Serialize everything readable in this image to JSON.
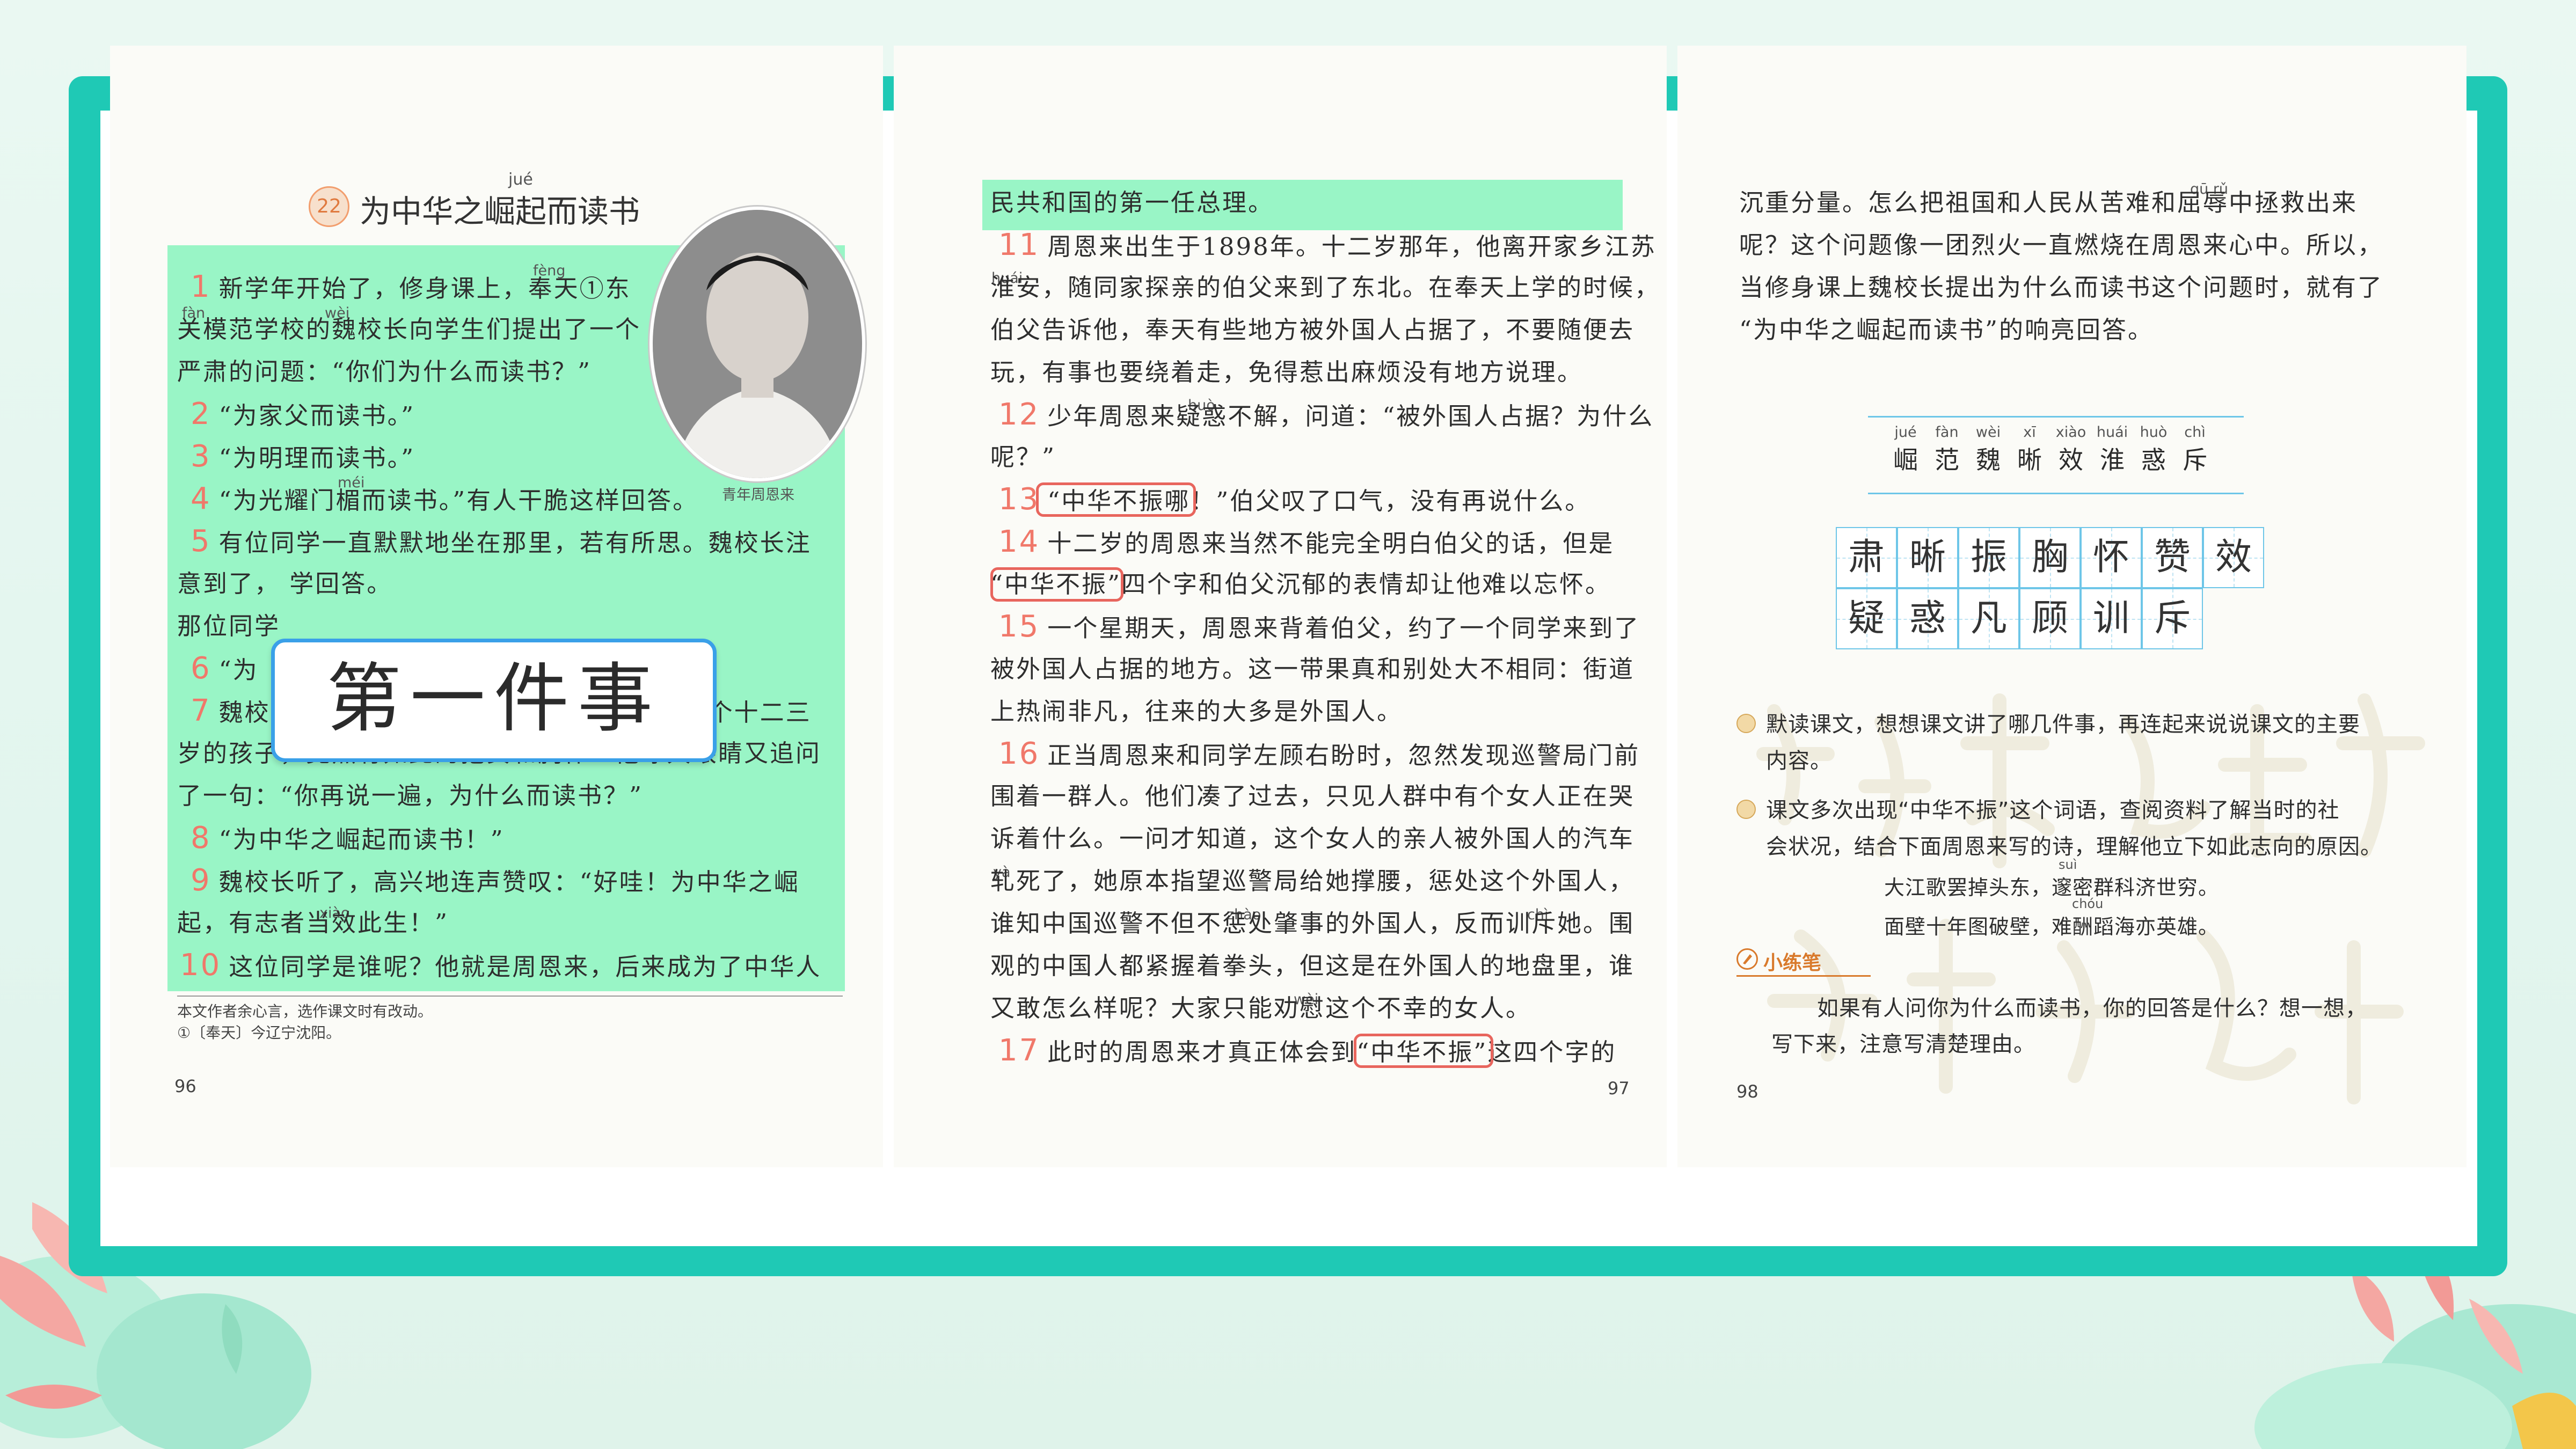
{
  "page1": {
    "lesson_number": "22",
    "title": "为中华之崛起而读书",
    "title_pinyin": "jué",
    "photo_caption": "青年周恩来",
    "lines": [
      {
        "num": "1",
        "text": "新学年开始了，修身课上，奉天①东"
      },
      {
        "num": "",
        "text": "关模范学校的魏校长向学生们提出了一个"
      },
      {
        "num": "",
        "text": "严肃的问题：“你们为什么而读书？”"
      },
      {
        "num": "2",
        "text": "“为家父而读书。”"
      },
      {
        "num": "3",
        "text": "“为明理而读书。”"
      },
      {
        "num": "4",
        "text": "“为光耀门楣而读书。”有人干脆这样回答。"
      },
      {
        "num": "5",
        "text": "有位同学一直默默地坐在那里，若有所思。魏校长注"
      },
      {
        "num": "",
        "text": "意到了，                                                    学回答。"
      },
      {
        "num": "",
        "text": "那位同学"
      },
      {
        "num": "6",
        "text": "“为"
      },
      {
        "num": "7",
        "text": "魏校长听了为之一振！他怎么也没想到，一个十二三"
      },
      {
        "num": "",
        "text": "岁的孩子，竟然有如此的抱负和胸怀！他睁大眼睛又追问"
      },
      {
        "num": "",
        "text": "了一句：“你再说一遍，为什么而读书？”"
      },
      {
        "num": "8",
        "text": "“为中华之崛起而读书！”"
      },
      {
        "num": "9",
        "text": "魏校长听了，高兴地连声赞叹：“好哇！为中华之崛"
      },
      {
        "num": "",
        "text": "起，有志者当效此生！”"
      },
      {
        "num": "10",
        "text": "这位同学是谁呢？他就是周恩来，后来成为了中华人"
      }
    ],
    "pinyin_notes": [
      "fèng",
      "fàn",
      "wèi",
      "méi",
      "xiào"
    ],
    "overlay_label": "第一件事",
    "footnote_1": "本文作者余心言，选作课文时有改动。",
    "footnote_2": "①〔奉天〕今辽宁沈阳。",
    "page_number": "96"
  },
  "page2": {
    "lines": [
      {
        "num": "",
        "text": "民共和国的第一任总理。"
      },
      {
        "num": "11",
        "text": "周恩来出生于1898年。十二岁那年，他离开家乡江苏"
      },
      {
        "num": "",
        "text": "淮安，随同家探亲的伯父来到了东北。在奉天上学的时候，"
      },
      {
        "num": "",
        "text": "伯父告诉他，奉天有些地方被外国人占据了，不要随便去"
      },
      {
        "num": "",
        "text": "玩，有事也要绕着走，免得惹出麻烦没有地方说理。"
      },
      {
        "num": "12",
        "text": "少年周恩来疑惑不解，问道：“被外国人占据？为什么"
      },
      {
        "num": "",
        "text": "呢？”"
      },
      {
        "num": "13",
        "text": "“中华不振哪！”伯父叹了口气，没有再说什么。"
      },
      {
        "num": "14",
        "text": "十二岁的周恩来当然不能完全明白伯父的话，但是"
      },
      {
        "num": "",
        "text": "“中华不振”四个字和伯父沉郁的表情却让他难以忘怀。"
      },
      {
        "num": "15",
        "text": "一个星期天，周恩来背着伯父，约了一个同学来到了"
      },
      {
        "num": "",
        "text": "被外国人占据的地方。这一带果真和别处大不相同：街道"
      },
      {
        "num": "",
        "text": "上热闹非凡，往来的大多是外国人。"
      },
      {
        "num": "16",
        "text": "正当周恩来和同学左顾右盼时，忽然发现巡警局门前"
      },
      {
        "num": "",
        "text": "围着一群人。他们凑了过去，只见人群中有个女人正在哭"
      },
      {
        "num": "",
        "text": "诉着什么。一问才知道，这个女人的亲人被外国人的汽车"
      },
      {
        "num": "",
        "text": "轧死了，她原本指望巡警局给她撑腰，惩处这个外国人，"
      },
      {
        "num": "",
        "text": "谁知中国巡警不但不惩处肇事的外国人，反而训斥她。围"
      },
      {
        "num": "",
        "text": "观的中国人都紧握着拳头，但这是在外国人的地盘里，谁"
      },
      {
        "num": "",
        "text": "又敢怎么样呢？大家只能劝慰这个不幸的女人。"
      },
      {
        "num": "17",
        "text": "此时的周恩来才真正体会到“中华不振”这四个字的"
      }
    ],
    "pinyin_notes": [
      "huái",
      "huò",
      "yà",
      "zhào",
      "chì",
      "wèi"
    ],
    "page_number": "97"
  },
  "page3": {
    "lines": [
      "沉重分量。怎么把祖国和人民从苦难和屈辱中拯救出来",
      "呢？这个问题像一团烈火一直燃烧在周恩来心中。所以，",
      "当修身课上魏校长提出为什么而读书这个问题时，就有了",
      "“为中华之崛起而读书”的响亮回答。"
    ],
    "quru_pinyin": "qū rǔ",
    "read_words": [
      {
        "char": "崛",
        "pinyin": "jué"
      },
      {
        "char": "范",
        "pinyin": "fàn"
      },
      {
        "char": "魏",
        "pinyin": "wèi"
      },
      {
        "char": "晰",
        "pinyin": "xī"
      },
      {
        "char": "效",
        "pinyin": "xiào"
      },
      {
        "char": "淮",
        "pinyin": "huái"
      },
      {
        "char": "惑",
        "pinyin": "huò"
      },
      {
        "char": "斥",
        "pinyin": "chì"
      }
    ],
    "write_row_1": [
      "肃",
      "晰",
      "振",
      "胸",
      "怀",
      "赞",
      "效"
    ],
    "write_row_2": [
      "疑",
      "惑",
      "凡",
      "顾",
      "训",
      "斥"
    ],
    "exercise_1_line_1": "默读课文，想想课文讲了哪几件事，再连起来说说课文的主要",
    "exercise_1_line_2": "内容。",
    "exercise_2_line_1": "课文多次出现“中华不振”这个词语，查阅资料了解当时的社",
    "exercise_2_line_2": "会状况，结合下面周恩来写的诗，理解他立下如此志向的原因。",
    "poem_line_1": "大江歌罢掉头东，邃密群科济世穷。",
    "poem_line_2": "面壁十年图破壁，难酬蹈海亦英雄。",
    "poem_pinyin_1": "suì",
    "poem_pinyin_2": "chóu",
    "practice_title": "小练笔",
    "practice_line_1": "如果有人问你为什么而读书，你的回答是什么？想一想，",
    "practice_line_2": "写下来，注意写清楚理由。",
    "page_number": "98"
  },
  "colors": {
    "frame": "#1fc9b5",
    "highlight": "#99f5c6",
    "paragraph_number": "#f0786a",
    "red_box": "#e8655d",
    "label_border": "#3aa0e8"
  }
}
